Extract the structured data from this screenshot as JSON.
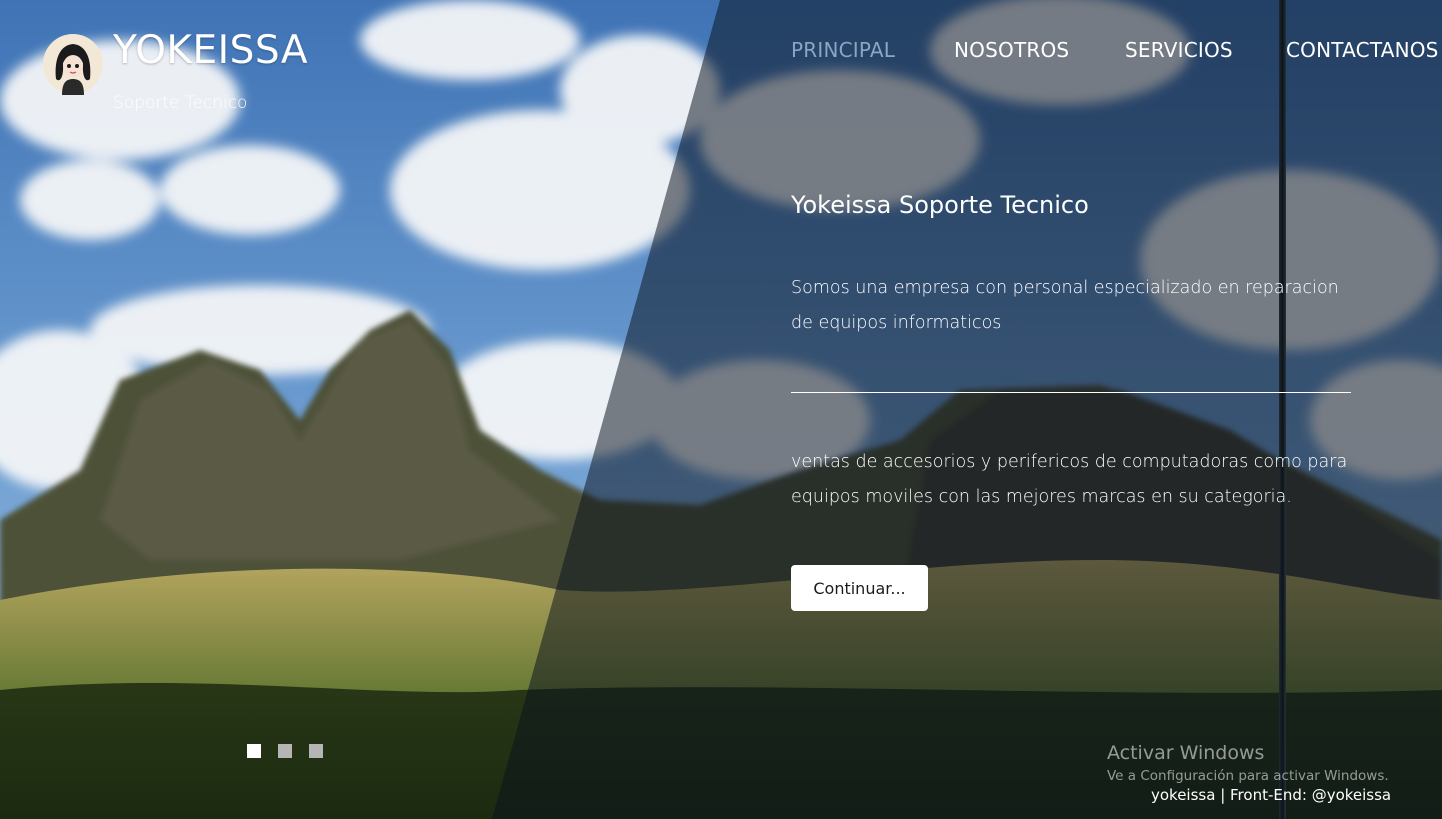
{
  "brand": {
    "name": "YOKEISSA",
    "tagline": "Soporte Tecnico"
  },
  "nav": {
    "items": [
      {
        "label": "PRINCIPAL",
        "active": true
      },
      {
        "label": "NOSOTROS",
        "active": false
      },
      {
        "label": "SERVICIOS",
        "active": false
      },
      {
        "label": "CONTACTANOS",
        "active": false
      }
    ]
  },
  "hero": {
    "title": "Yokeissa Soporte Tecnico",
    "paragraph1": "Somos una empresa con personal especializado en reparacion de equipos informaticos",
    "paragraph2": "ventas de accesorios y perifericos de computadoras como para equipos moviles con las mejores marcas en su categoria.",
    "button_label": "Continuar..."
  },
  "slider": {
    "count": 3,
    "active_index": 0
  },
  "watermark": {
    "title": "Activar Windows",
    "subtitle": "Ve a Configuración para activar Windows."
  },
  "footer": {
    "credit": "yokeissa | Front-End: @yokeissa"
  },
  "colors": {
    "nav_active": "#8aa6c2",
    "text": "#ffffff",
    "dot_active": "#ffffff",
    "dot_inactive": "#b5b5b5"
  }
}
